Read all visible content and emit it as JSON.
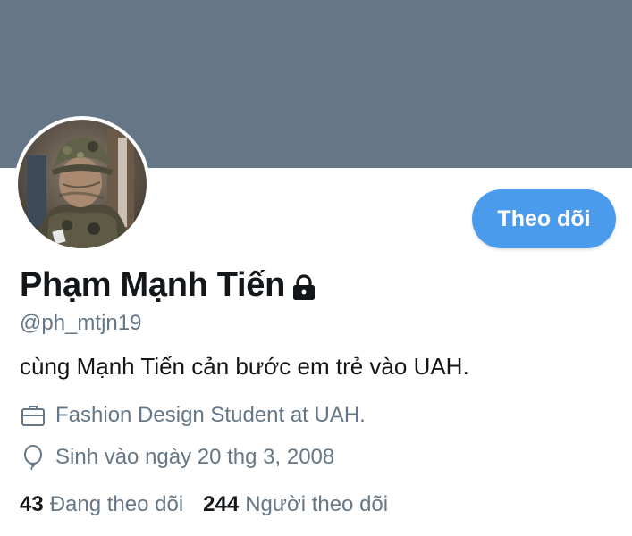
{
  "profile": {
    "display_name": "Phạm Mạnh Tiến",
    "handle": "@ph_mtjn19",
    "bio": "cùng Mạnh Tiến cản bước em trẻ vào UAH.",
    "job": "Fashion Design Student at UAH.",
    "birth": "Sinh vào ngày 20 thg 3, 2008",
    "protected_icon": "lock-icon",
    "job_icon": "briefcase-icon",
    "birth_icon": "balloon-icon"
  },
  "actions": {
    "follow_label": "Theo dõi"
  },
  "stats": {
    "following_count": "43",
    "following_label": "Đang theo dõi",
    "followers_count": "244",
    "followers_label": "Người theo dõi"
  },
  "colors": {
    "banner": "#657786",
    "accent": "#4b9bec",
    "text_primary": "#14171a",
    "text_secondary": "#657786"
  }
}
